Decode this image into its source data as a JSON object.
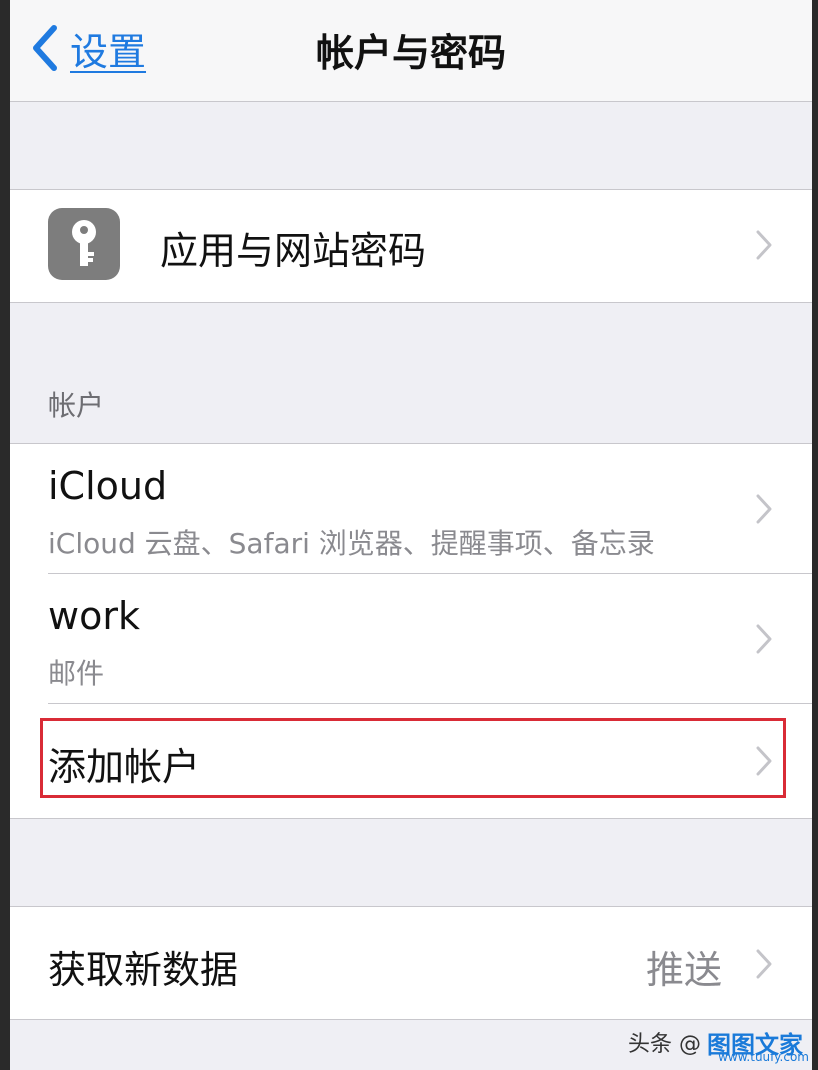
{
  "navbar": {
    "back_label": "设置",
    "title": "帐户与密码"
  },
  "passwords_row": {
    "icon": "key-icon",
    "label": "应用与网站密码"
  },
  "accounts_section": {
    "header": "帐户",
    "accounts": [
      {
        "title": "iCloud",
        "subtitle": "iCloud 云盘、Safari 浏览器、提醒事项、备忘录"
      },
      {
        "title": "work",
        "subtitle": "邮件"
      }
    ],
    "add_account_label": "添加帐户"
  },
  "fetch_row": {
    "label": "获取新数据",
    "value": "推送"
  },
  "watermark": {
    "text": "头条 @",
    "brand": "图图文家",
    "url": "www.tuufy.com"
  },
  "colors": {
    "accent": "#1f7ae0",
    "highlight": "#d92b36",
    "background": "#efeff4"
  }
}
